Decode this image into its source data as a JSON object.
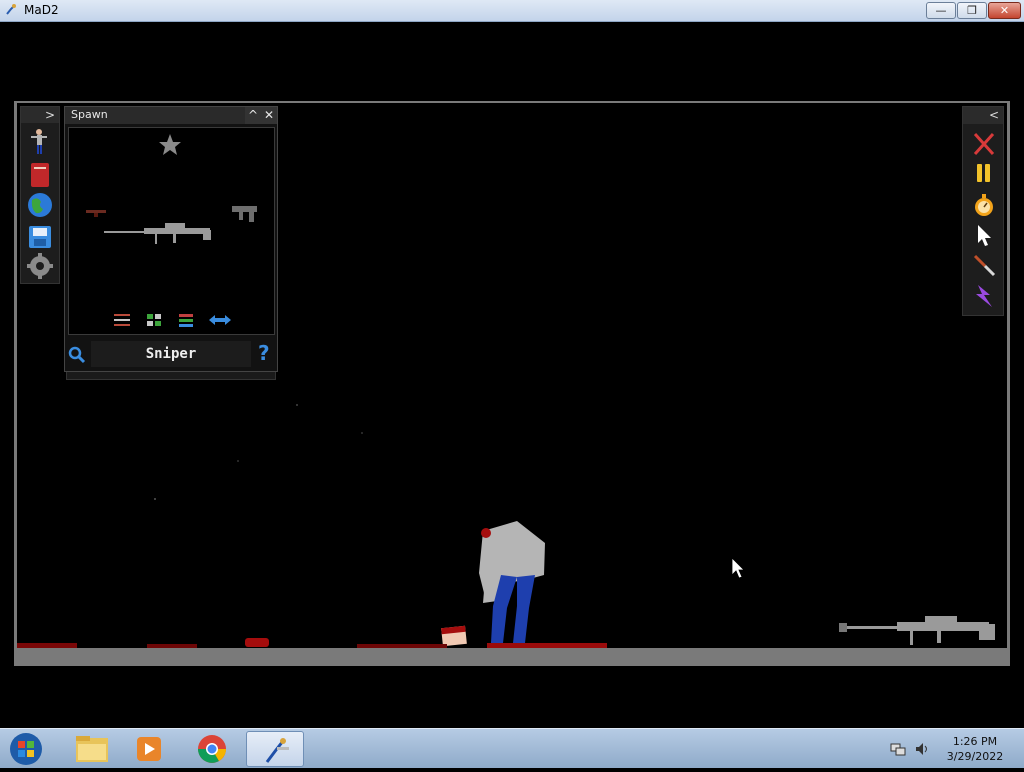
{
  "window": {
    "title": "MaD2",
    "minimize_glyph": "—",
    "maximize_glyph": "❐",
    "close_glyph": "✕"
  },
  "left_toolbar": {
    "expand_glyph": ">",
    "tools": [
      {
        "icon": "ragdoll-icon"
      },
      {
        "icon": "book-icon"
      },
      {
        "icon": "globe-icon"
      },
      {
        "icon": "save-icon"
      },
      {
        "icon": "settings-icon"
      }
    ]
  },
  "spawn_panel": {
    "title": "Spawn",
    "collapse_glyph": "^",
    "close_glyph": "✕",
    "favorite_icon": "star-icon",
    "items": [
      {
        "icon": "small-gun-icon"
      },
      {
        "icon": "smg-icon"
      },
      {
        "icon": "sniper-rifle-icon"
      }
    ],
    "filters": [
      {
        "icon": "sliders-icon"
      },
      {
        "icon": "grid-view-icon"
      },
      {
        "icon": "list-view-icon"
      },
      {
        "icon": "swap-arrows-icon"
      }
    ],
    "search_icon": "search-icon",
    "search_value": "Sniper",
    "help_glyph": "?"
  },
  "right_toolbar": {
    "collapse_glyph": "<",
    "tools": [
      {
        "icon": "clear-x-icon"
      },
      {
        "icon": "pause-icon"
      },
      {
        "icon": "stopwatch-icon"
      },
      {
        "icon": "cursor-icon"
      },
      {
        "icon": "knife-icon"
      },
      {
        "icon": "lightning-icon"
      }
    ]
  },
  "taskbar": {
    "items": [
      "start-orb",
      "file-explorer",
      "media-player",
      "chrome",
      "mad2-game"
    ],
    "clock_time": "1:26 PM",
    "clock_date": "3/29/2022"
  },
  "colors": {
    "background": "#000000",
    "frame": "#7a7a7a",
    "blood": "#a50d0d",
    "ragdoll_shirt": "#b5b5b5",
    "ragdoll_pants": "#1e3fae"
  }
}
